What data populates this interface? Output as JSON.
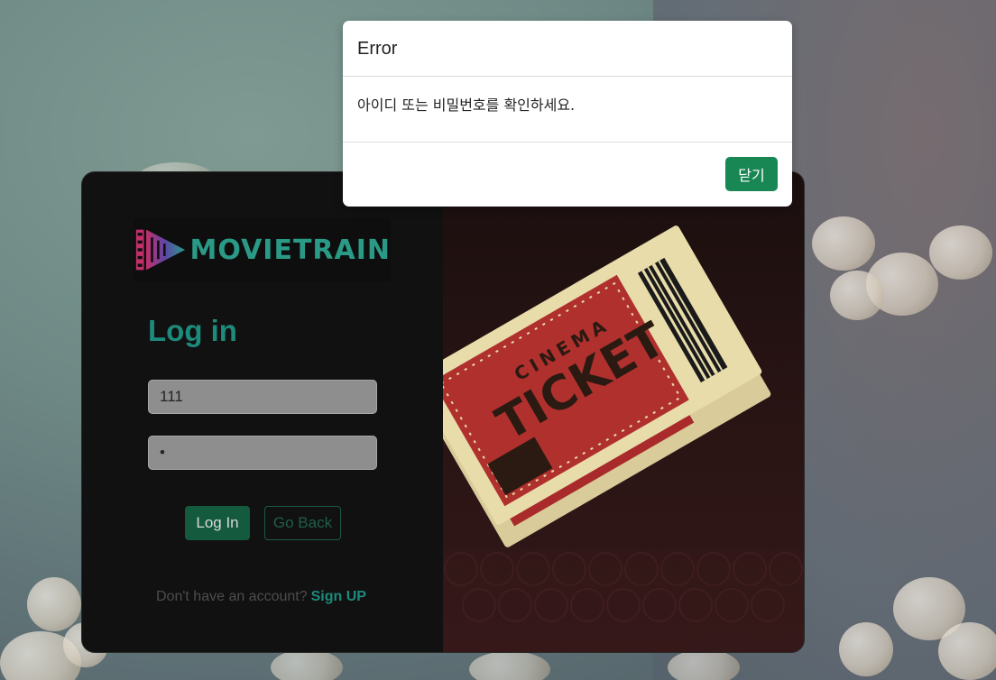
{
  "modal": {
    "title": "Error",
    "message": "아이디 또는 비밀번호를 확인하세요.",
    "close_label": "닫기"
  },
  "brand": {
    "logo_text": "MOVIETRAIN",
    "accent_color": "#1d8a7c"
  },
  "login": {
    "title": "Log in",
    "username_value": "111",
    "password_value": "•",
    "login_button": "Log In",
    "back_button": "Go Back",
    "signup_prompt": "Don't have an account?",
    "signup_link": "Sign UP"
  },
  "illustration": {
    "ticket_title": "TICKET",
    "ticket_subtitle": "CINEMA"
  },
  "colors": {
    "modal_button": "#198754",
    "login_button": "#145a3e"
  }
}
